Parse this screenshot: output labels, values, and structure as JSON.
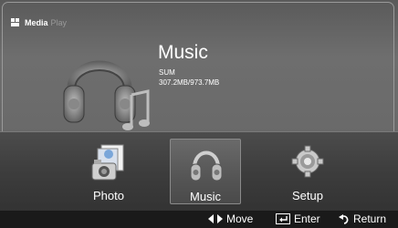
{
  "app": {
    "logo_main": "Media",
    "logo_sub": "Play"
  },
  "hero": {
    "title": "Music",
    "subtitle": "SUM",
    "size": "307.2MB/973.7MB"
  },
  "menu": {
    "items": [
      {
        "label": "Photo",
        "icon": "photo-icon"
      },
      {
        "label": "Music",
        "icon": "headphones-icon",
        "selected": true
      },
      {
        "label": "Setup",
        "icon": "gear-icon"
      }
    ]
  },
  "footer": {
    "move": "Move",
    "enter": "Enter",
    "return": "Return"
  },
  "colors": {
    "background": "#6a6a6a",
    "footer": "#1a1a1a",
    "text": "#ffffff"
  }
}
